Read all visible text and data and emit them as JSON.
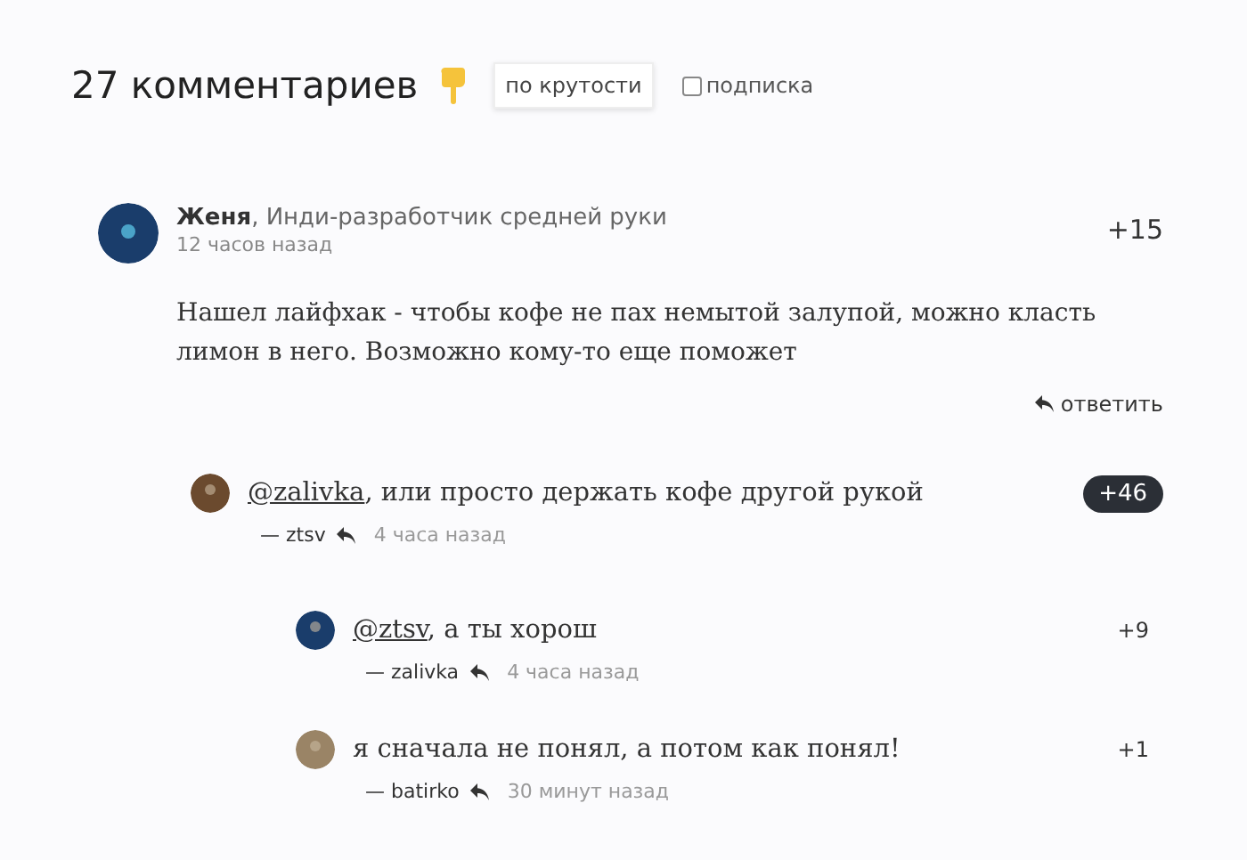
{
  "header": {
    "title": "27 комментариев",
    "sort": "по крутости",
    "subscribe": {
      "label": "подписка",
      "checked": false
    }
  },
  "comments": [
    {
      "kind": "top",
      "author": "Женя",
      "role": ", Инди-разработчик средней руки",
      "time": "12 часов назад",
      "score": "+15",
      "highlighted": false,
      "text": "Нашел лайфхак - чтобы кофе не пах немытой залупой, можно класть лимон в него. Возможно кому-то еще поможет",
      "reply": "ответить",
      "children": [
        {
          "kind": "reply",
          "mention": "@zalivka",
          "text": ", или просто держать кофе другой рукой",
          "author": "— ztsv",
          "time": "4 часа назад",
          "score": "+46",
          "highlighted": true,
          "children": [
            {
              "kind": "reply",
              "mention": "@ztsv",
              "text": ", а ты хорош",
              "author": "— zalivka",
              "time": "4 часа назад",
              "score": "+9",
              "highlighted": false
            },
            {
              "kind": "reply",
              "text": "я сначала не понял, а потом как понял!",
              "author": "— batirko",
              "time": "30 минут назад",
              "score": "+1",
              "highlighted": false
            }
          ]
        }
      ]
    }
  ]
}
